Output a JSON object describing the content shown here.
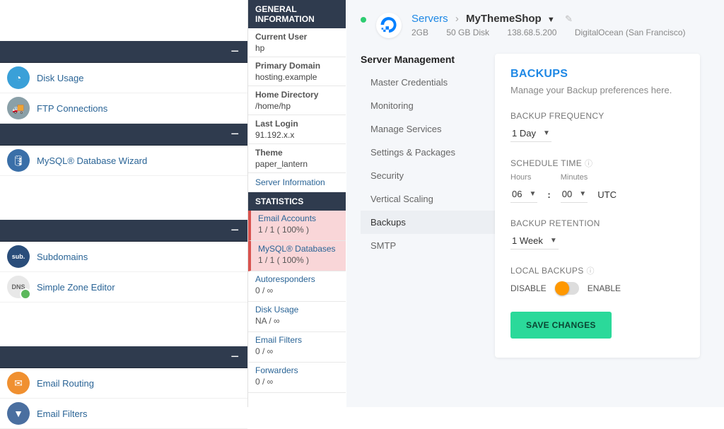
{
  "cpanel": {
    "left": {
      "groups": [
        {
          "blank_height": 58,
          "items": [
            {
              "icon_bg": "#3aa0d8",
              "icon": "◔",
              "label": "Disk Usage",
              "name": "disk-usage"
            },
            {
              "icon_bg": "#8aa0a8",
              "icon": "🚚",
              "label": "FTP Connections",
              "name": "ftp-connections"
            }
          ]
        },
        {
          "items": [
            {
              "icon_bg": "#3a6fa8",
              "icon": "🛢",
              "label": "MySQL® Database Wizard",
              "name": "mysql-db-wizard"
            }
          ]
        },
        {
          "blank_height": 62,
          "items": [
            {
              "icon_bg": "#2a4d7a",
              "icon_text": "sub.",
              "label": "Subdomains",
              "name": "subdomains"
            },
            {
              "icon_bg": "#e8e8e8",
              "icon_text": "DNS",
              "icon_color": "#666",
              "label": "Simple Zone Editor",
              "name": "simple-zone-editor",
              "badge": true
            }
          ]
        },
        {
          "blank_height": 62,
          "items": [
            {
              "icon_bg": "#f09030",
              "icon": "✉",
              "label": "Email Routing",
              "name": "email-routing"
            },
            {
              "icon_bg": "#4a6fa0",
              "icon": "▼",
              "label": "Email Filters",
              "name": "email-filters"
            }
          ]
        }
      ]
    },
    "right": {
      "general": {
        "title": "GENERAL INFORMATION",
        "rows": [
          {
            "k": "Current User",
            "v": "hp"
          },
          {
            "k": "Primary Domain",
            "v": "hosting.example"
          },
          {
            "k": "Home Directory",
            "v": "/home/hp"
          },
          {
            "k": "Last Login",
            "v": "91.192.x.x"
          },
          {
            "k": "Theme",
            "v": "paper_lantern"
          }
        ],
        "link": "Server Information"
      },
      "stats": {
        "title": "STATISTICS",
        "rows": [
          {
            "k": "Email Accounts",
            "v": "1 / 1 ( 100% )",
            "red": true
          },
          {
            "k": "MySQL® Databases",
            "v": "1 / 1 ( 100% )",
            "red": true
          },
          {
            "k": "Autoresponders",
            "v": "0 / ∞"
          },
          {
            "k": "Disk Usage",
            "v": "NA / ∞"
          },
          {
            "k": "Email Filters",
            "v": "0 / ∞"
          },
          {
            "k": "Forwarders",
            "v": "0 / ∞"
          }
        ]
      }
    }
  },
  "cloud": {
    "breadcrumb": {
      "servers": "Servers",
      "name": "MyThemeShop"
    },
    "meta": {
      "ram": "2GB",
      "disk": "50 GB Disk",
      "ip": "138.68.5.200",
      "provider": "DigitalOcean (San Francisco)"
    },
    "nav": {
      "title": "Server Management",
      "items": [
        "Master Credentials",
        "Monitoring",
        "Manage Services",
        "Settings & Packages",
        "Security",
        "Vertical Scaling",
        "Backups",
        "SMTP"
      ],
      "active": 6
    },
    "card": {
      "title": "BACKUPS",
      "sub": "Manage your Backup preferences here.",
      "freq": {
        "k": "BACKUP FREQUENCY",
        "v": "1 Day"
      },
      "time": {
        "k": "SCHEDULE TIME",
        "hours_l": "Hours",
        "hours": "06",
        "mins_l": "Minutes",
        "mins": "00",
        "tz": "UTC"
      },
      "ret": {
        "k": "BACKUP RETENTION",
        "v": "1 Week"
      },
      "local": {
        "k": "LOCAL BACKUPS",
        "off": "DISABLE",
        "on": "ENABLE"
      },
      "save": "SAVE CHANGES"
    }
  }
}
